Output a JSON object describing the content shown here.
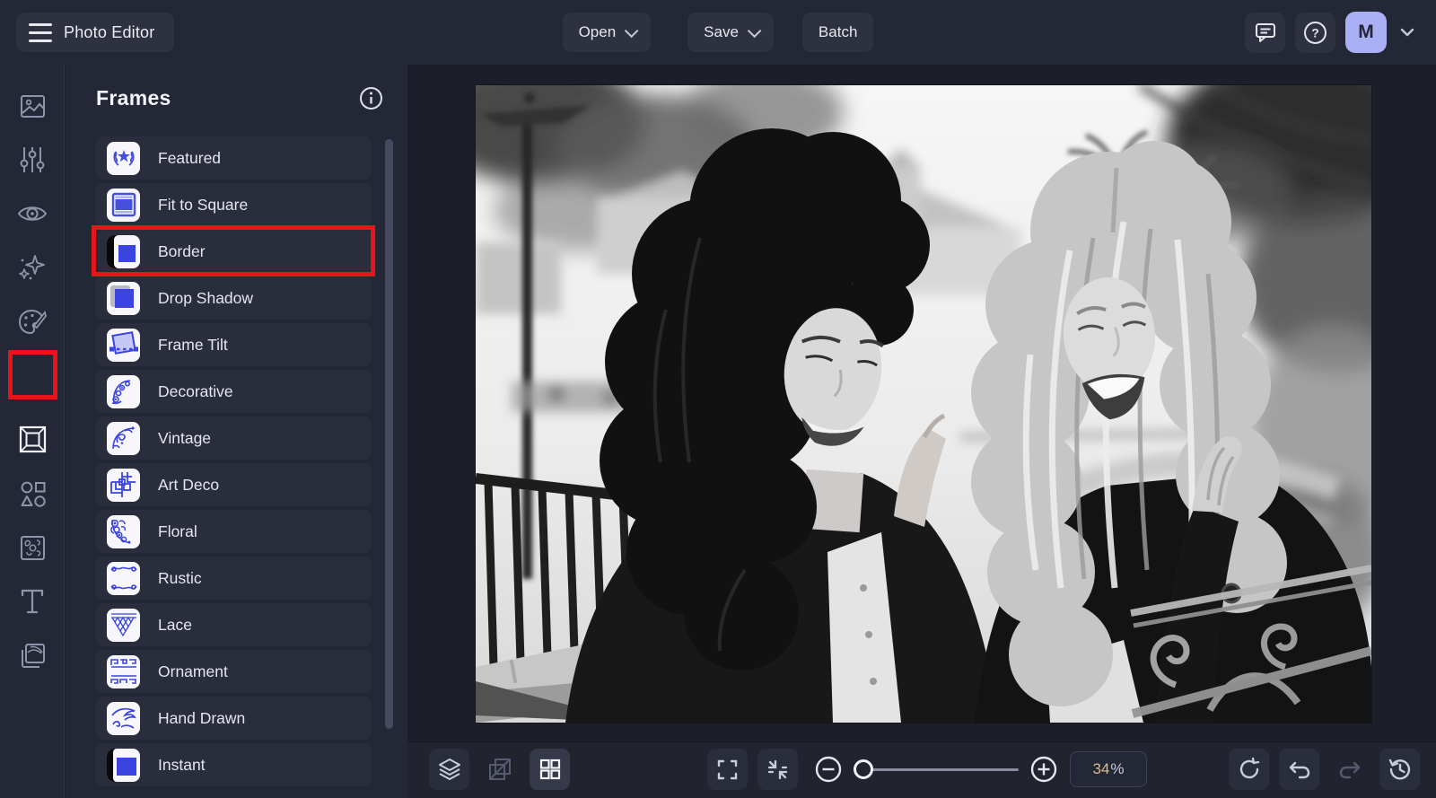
{
  "app": {
    "title": "Photo Editor"
  },
  "topbar": {
    "open_label": "Open",
    "save_label": "Save",
    "batch_label": "Batch",
    "icons": [
      "hamburger-icon",
      "chat-icon",
      "help-icon",
      "chevron-down-icon"
    ],
    "avatar_initial": "M",
    "avatar_bg": "#a9b0f4"
  },
  "sidebar": {
    "icons": [
      {
        "name": "image-icon"
      },
      {
        "name": "adjust-sliders-icon"
      },
      {
        "name": "eye-icon"
      },
      {
        "name": "sparkles-icon"
      },
      {
        "name": "palette-icon"
      },
      {
        "name": "frame-icon",
        "active": true
      },
      {
        "name": "shapes-icon"
      },
      {
        "name": "overlay-texture-icon"
      },
      {
        "name": "text-icon"
      },
      {
        "name": "layers-copy-icon"
      }
    ]
  },
  "frames_panel": {
    "title": "Frames",
    "info_icon": "info-icon",
    "items": [
      {
        "label": "Featured",
        "icon": "laurel-star-icon"
      },
      {
        "label": "Fit to Square",
        "icon": "fit-square-icon"
      },
      {
        "label": "Border",
        "icon": "border-frame-icon",
        "highlighted": true
      },
      {
        "label": "Drop Shadow",
        "icon": "drop-shadow-icon"
      },
      {
        "label": "Frame Tilt",
        "icon": "frame-tilt-icon"
      },
      {
        "label": "Decorative",
        "icon": "decorative-corner-icon"
      },
      {
        "label": "Vintage",
        "icon": "vintage-flourish-icon"
      },
      {
        "label": "Art Deco",
        "icon": "art-deco-icon"
      },
      {
        "label": "Floral",
        "icon": "floral-corner-icon"
      },
      {
        "label": "Rustic",
        "icon": "rustic-scroll-icon"
      },
      {
        "label": "Lace",
        "icon": "lace-icon"
      },
      {
        "label": "Ornament",
        "icon": "ornament-meander-icon"
      },
      {
        "label": "Hand Drawn",
        "icon": "hand-drawn-icon"
      },
      {
        "label": "Instant",
        "icon": "instant-polaroid-icon"
      }
    ],
    "accent_blue": "#4650dd",
    "highlight_red": "#e81417"
  },
  "canvas": {
    "photo_alt": "Black and white photo of two laughing women outdoors by an iron fence with palm trees"
  },
  "bottom_toolbar": {
    "zoom_number": "34",
    "zoom_unit": "%",
    "icons": [
      "layers-icon",
      "compare-icon",
      "grid-view-icon",
      "fullscreen-icon",
      "fit-screen-icon",
      "zoom-out-icon",
      "zoom-slider",
      "zoom-in-icon",
      "reset-icon",
      "undo-icon",
      "redo-icon",
      "history-icon"
    ]
  }
}
